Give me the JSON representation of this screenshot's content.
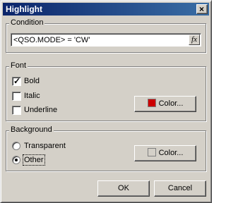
{
  "window": {
    "title": "Highlight",
    "close_label": "×"
  },
  "condition": {
    "group_label": "Condition",
    "expression": "<QSO.MODE> = 'CW'",
    "fx_label": "fx"
  },
  "font": {
    "group_label": "Font",
    "bold_label": "Bold",
    "bold_checked": true,
    "italic_label": "Italic",
    "italic_checked": false,
    "underline_label": "Underline",
    "underline_checked": false,
    "color_button_label": "Color...",
    "color": "#cc0000"
  },
  "background": {
    "group_label": "Background",
    "transparent_label": "Transparent",
    "other_label": "Other",
    "selected": "Other",
    "color_button_label": "Color...",
    "color": "#d4d0c8"
  },
  "buttons": {
    "ok_label": "OK",
    "cancel_label": "Cancel"
  }
}
